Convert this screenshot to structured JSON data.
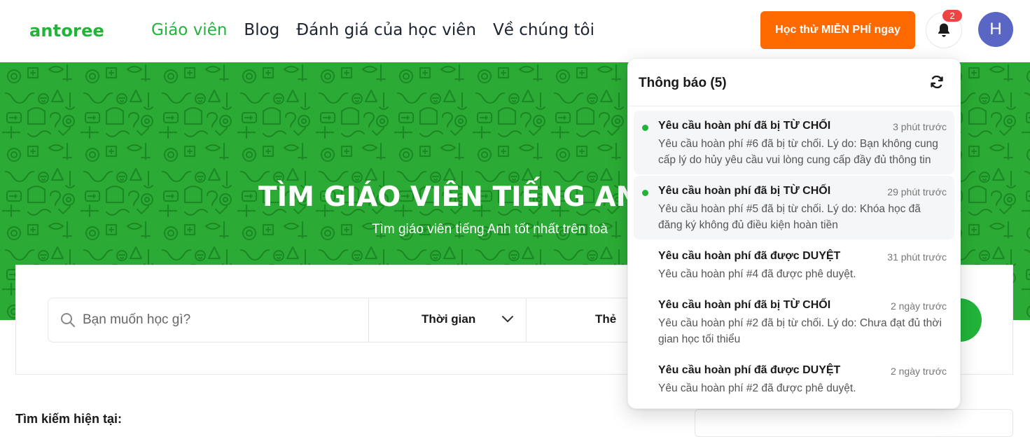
{
  "brand": {
    "logo": "antoree",
    "color": "#22b33b"
  },
  "nav": {
    "items": [
      {
        "label": "Giáo viên",
        "active": true
      },
      {
        "label": "Blog",
        "active": false
      },
      {
        "label": "Đánh giá của học viên",
        "active": false
      },
      {
        "label": "Về chúng tôi",
        "active": false
      }
    ]
  },
  "header": {
    "cta_label": "Học thử MIỄN PHÍ ngay",
    "cta_color": "#ff6a00",
    "notif_count": "2",
    "avatar_initial": "H",
    "bell_icon": "bell-icon"
  },
  "hero": {
    "title": "TÌM GIÁO VIÊN TIẾNG ANH",
    "subtitle": "Tìm giáo viên tiếng Anh tốt nhất trên toà"
  },
  "search": {
    "placeholder": "Bạn muốn học gì?",
    "time_label": "Thời gian",
    "the_label": "Thẻ"
  },
  "current_search_label": "Tìm kiếm hiện tại:",
  "notifications": {
    "title": "Thông báo (5)",
    "items": [
      {
        "title": "Yêu cầu hoàn phí đã bị TỪ CHỐI",
        "time": "3 phút trước",
        "body": "Yêu cầu hoàn phí #6 đã bị từ chối. Lý do: Bạn không cung cấp lý do hủy yêu cầu vui lòng cung cấp đầy đủ thông tin",
        "unread": true
      },
      {
        "title": "Yêu cầu hoàn phí đã bị TỪ CHỐI",
        "time": "29 phút trước",
        "body": "Yêu cầu hoàn phí #5 đã bị từ chối. Lý do: Khóa học đã đăng ký không đủ điều kiện hoàn tiền",
        "unread": true
      },
      {
        "title": "Yêu cầu hoàn phí đã được DUYỆT",
        "time": "31 phút trước",
        "body": "Yêu cầu hoàn phí #4 đã được phê duyệt.",
        "unread": false
      },
      {
        "title": "Yêu cầu hoàn phí đã bị TỪ CHỐI",
        "time": "2 ngày trước",
        "body": "Yêu cầu hoàn phí #2 đã bị từ chối. Lý do: Chưa đạt đủ thời gian học tối thiểu",
        "unread": false
      },
      {
        "title": "Yêu cầu hoàn phí đã được DUYỆT",
        "time": "2 ngày trước",
        "body": "Yêu cầu hoàn phí #2 đã được phê duyệt.",
        "unread": false
      }
    ]
  }
}
